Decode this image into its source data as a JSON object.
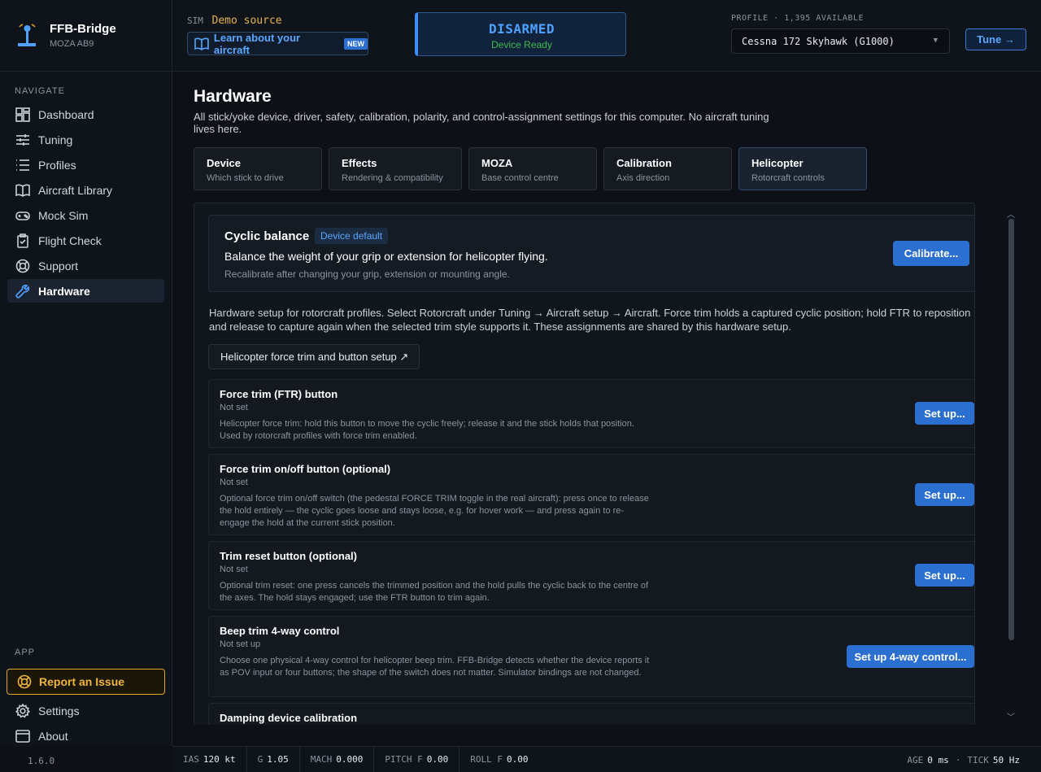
{
  "brand": {
    "title": "FFB-Bridge",
    "subtitle": "MOZA AB9"
  },
  "nav": {
    "heading": "NAVIGATE",
    "items": [
      {
        "label": "Dashboard",
        "icon": "dashboard-icon"
      },
      {
        "label": "Tuning",
        "icon": "sliders-icon"
      },
      {
        "label": "Profiles",
        "icon": "list-icon"
      },
      {
        "label": "Aircraft Library",
        "icon": "book-icon"
      },
      {
        "label": "Mock Sim",
        "icon": "gamepad-icon"
      },
      {
        "label": "Flight Check",
        "icon": "clipboard-icon"
      },
      {
        "label": "Support",
        "icon": "lifebuoy-icon"
      },
      {
        "label": "Hardware",
        "icon": "wrench-icon",
        "active": true
      }
    ]
  },
  "app": {
    "heading": "APP",
    "report_label": "Report an Issue",
    "settings_label": "Settings",
    "about_label": "About",
    "version": "1.6.0"
  },
  "topbar": {
    "sim_label": "SIM",
    "sim_value": "Demo source",
    "learn_label": "Learn about your aircraft",
    "new_badge": "NEW",
    "status_title": "DISARMED",
    "status_sub": "Device Ready",
    "profile_label": "PROFILE · 1,395 AVAILABLE",
    "profile_value": "Cessna 172 Skyhawk (G1000)",
    "tune_label": "Tune →"
  },
  "page": {
    "title": "Hardware",
    "description": "All stick/yoke device, driver, safety, calibration, polarity, and control-assignment settings for this computer. No aircraft tuning lives here."
  },
  "tabs": [
    {
      "title": "Device",
      "sub": "Which stick to drive"
    },
    {
      "title": "Effects",
      "sub": "Rendering & compatibility"
    },
    {
      "title": "MOZA",
      "sub": "Base control centre"
    },
    {
      "title": "Calibration",
      "sub": "Axis direction"
    },
    {
      "title": "Helicopter",
      "sub": "Rotorcraft controls",
      "active": true
    }
  ],
  "balance": {
    "title": "Cyclic balance",
    "badge": "Device default",
    "desc": "Balance the weight of your grip or extension for helicopter flying.",
    "note": "Recalibrate after changing your grip, extension or mounting angle.",
    "button": "Calibrate..."
  },
  "intro": "Hardware setup for rotorcraft profiles. Select Rotorcraft under Tuning → Aircraft setup → Aircraft. Force trim holds a captured cyclic position; hold FTR to reposition and release to capture again when the selected trim style supports it. These assignments are shared by this hardware setup.",
  "heli_button": "Helicopter force trim and button setup ↗",
  "rows": [
    {
      "title": "Force trim (FTR) button",
      "status": "Not set",
      "desc": "Helicopter force trim: hold this button to move the cyclic freely; release it and the stick holds that position. Used by rotorcraft profiles with force trim enabled.",
      "button": "Set up..."
    },
    {
      "title": "Force trim on/off button (optional)",
      "status": "Not set",
      "desc": "Optional force trim on/off switch (the pedestal FORCE TRIM toggle in the real aircraft): press once to release the hold entirely — the cyclic goes loose and stays loose, e.g. for hover work — and press again to re-engage the hold at the current stick position.",
      "button": "Set up..."
    },
    {
      "title": "Trim reset button (optional)",
      "status": "Not set",
      "desc": "Optional trim reset: one press cancels the trimmed position and the hold pulls the cyclic back to the centre of the axes. The hold stays engaged; use the FTR button to trim again.",
      "button": "Set up..."
    },
    {
      "title": "Beep trim 4-way control",
      "status": "Not set up",
      "desc": "Choose one physical 4-way control for helicopter beep trim. FFB-Bridge detects whether the device reports it as POV input or four buttons; the shape of the switch does not matter. Simulator bindings are not changed.",
      "button": "Set up 4-way control..."
    },
    {
      "title": "Damping device calibration",
      "status": "",
      "desc": "",
      "button": ""
    }
  ],
  "footer": {
    "ias_label": "IAS",
    "ias_value": "120 kt",
    "g_label": "G",
    "g_value": "1.05",
    "mach_label": "MACH",
    "mach_value": "0.000",
    "pitch_label": "PITCH F",
    "pitch_value": "0.00",
    "roll_label": "ROLL F",
    "roll_value": "0.00",
    "age_label": "AGE",
    "age_value": "0 ms",
    "tick_label": "TICK",
    "tick_value": "50 Hz"
  },
  "colors": {
    "accent": "#2b6fd1",
    "warning": "#e0a526",
    "ok": "#3fb950"
  }
}
